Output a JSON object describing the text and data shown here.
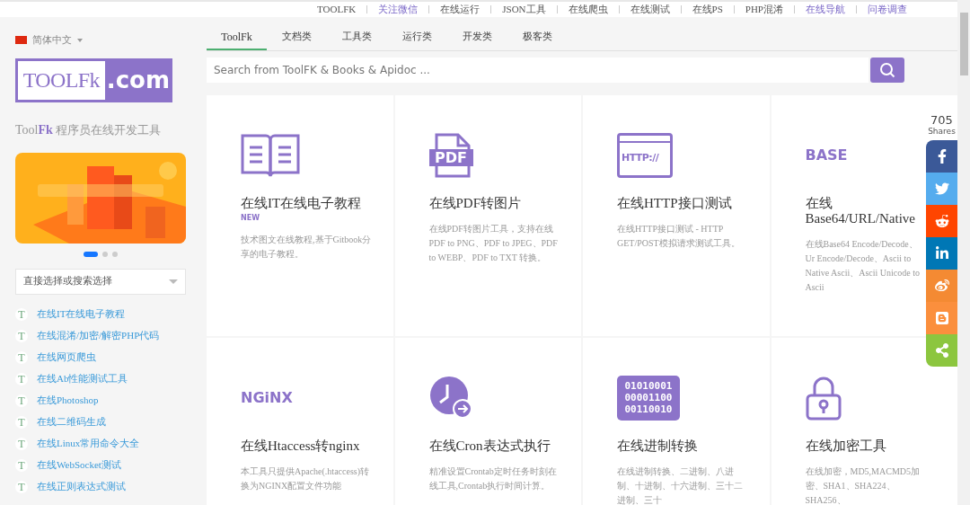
{
  "top_links": [
    {
      "label": "TOOLFK",
      "highlighted": false
    },
    {
      "label": "关注微信",
      "highlighted": true
    },
    {
      "label": "在线运行",
      "highlighted": false
    },
    {
      "label": "JSON工具",
      "highlighted": false
    },
    {
      "label": "在线爬虫",
      "highlighted": false
    },
    {
      "label": "在线测试",
      "highlighted": false
    },
    {
      "label": "在线PS",
      "highlighted": false
    },
    {
      "label": "PHP混淆",
      "highlighted": false
    },
    {
      "label": "在线导航",
      "highlighted": true
    },
    {
      "label": "问卷调查",
      "highlighted": true
    }
  ],
  "sidebar": {
    "language": "简体中文",
    "logo": {
      "left": "TOOLFk",
      "right": ".com"
    },
    "tagline": {
      "brand": "Tool",
      "brand_accent": "Fk",
      "text": "程序员在线开发工具"
    },
    "carousel_dots": [
      {
        "selected": true
      },
      {
        "selected": false
      },
      {
        "selected": false
      }
    ],
    "select": {
      "placeholder": "直接选择或搜索选择"
    },
    "items": [
      {
        "badge": "T",
        "label": "在线IT在线电子教程"
      },
      {
        "badge": "T",
        "label": "在线混淆/加密/解密PHP代码"
      },
      {
        "badge": "T",
        "label": "在线网页爬虫"
      },
      {
        "badge": "T",
        "label": "在线Ab性能测试工具"
      },
      {
        "badge": "T",
        "label": "在线Photoshop"
      },
      {
        "badge": "T",
        "label": "在线二维码生成"
      },
      {
        "badge": "T",
        "label": "在线Linux常用命令大全"
      },
      {
        "badge": "T",
        "label": "在线WebSocket测试"
      },
      {
        "badge": "T",
        "label": "在线正则表达式测试"
      }
    ]
  },
  "tabs": [
    {
      "label": "ToolFk",
      "selected": true
    },
    {
      "label": "文档类",
      "selected": false
    },
    {
      "label": "工具类",
      "selected": false
    },
    {
      "label": "运行类",
      "selected": false
    },
    {
      "label": "开发类",
      "selected": false
    },
    {
      "label": "极客类",
      "selected": false
    }
  ],
  "search": {
    "placeholder": "Search from ToolFK & Books & Apidoc ..."
  },
  "cards": [
    {
      "icon": {
        "kind": "book"
      },
      "title": "在线IT在线电子教程",
      "badge": "NEW",
      "description": "技术图文在线教程,基于Gitbook分享的电子教程。"
    },
    {
      "icon": {
        "kind": "pdf",
        "text": "PDF"
      },
      "title": "在线PDF转图片",
      "description": "在线PDF转图片工具，支持在线PDF to PNG、PDF to JPEG、PDF to WEBP、PDF to TXT 转换。"
    },
    {
      "icon": {
        "kind": "http",
        "text": "HTTP://"
      },
      "title": "在线HTTP接口测试",
      "description": "在线HTTP接口测试 - HTTP GET/POST模拟请求测试工具。"
    },
    {
      "icon": {
        "kind": "word",
        "text": "BASE"
      },
      "title": "在线Base64/URL/Native",
      "description": "在线Base64 Encode/Decode、Ur Encode/Decode、Ascii to Native Ascii、Ascii Unicode to Ascii"
    },
    {
      "icon": {
        "kind": "word",
        "text": "NGiNX"
      },
      "title": "在线Htaccess转nginx",
      "description": "本工具只提供Apache(.htaccess)转换为NGINX配置文件功能"
    },
    {
      "icon": {
        "kind": "clock"
      },
      "title": "在线Cron表达式执行",
      "description": "精准设置Crontab定时任务时刻在线工具,Crontab执行时间计算。"
    },
    {
      "icon": {
        "kind": "binary",
        "lines": [
          "01010001",
          "00001100",
          "00110010"
        ]
      },
      "title": "在线进制转换",
      "description": "在线进制转换、二进制、八进制、十进制、十六进制、三十二进制、三十"
    },
    {
      "icon": {
        "kind": "lock"
      },
      "title": "在线加密工具",
      "description": "在线加密，MD5,MACMD5加密、SHA1、SHA224、SHA256、"
    }
  ],
  "share": {
    "count": "705",
    "label": "Shares",
    "buttons": [
      {
        "kind": "facebook",
        "color": "#3b5998"
      },
      {
        "kind": "twitter",
        "color": "#55acee"
      },
      {
        "kind": "reddit",
        "color": "#ff4500"
      },
      {
        "kind": "linkedin",
        "color": "#0077b5"
      },
      {
        "kind": "weibo",
        "color": "#f48a33"
      },
      {
        "kind": "blogger",
        "color": "#fb8f3d"
      },
      {
        "kind": "share",
        "color": "#8cc63f"
      }
    ]
  }
}
